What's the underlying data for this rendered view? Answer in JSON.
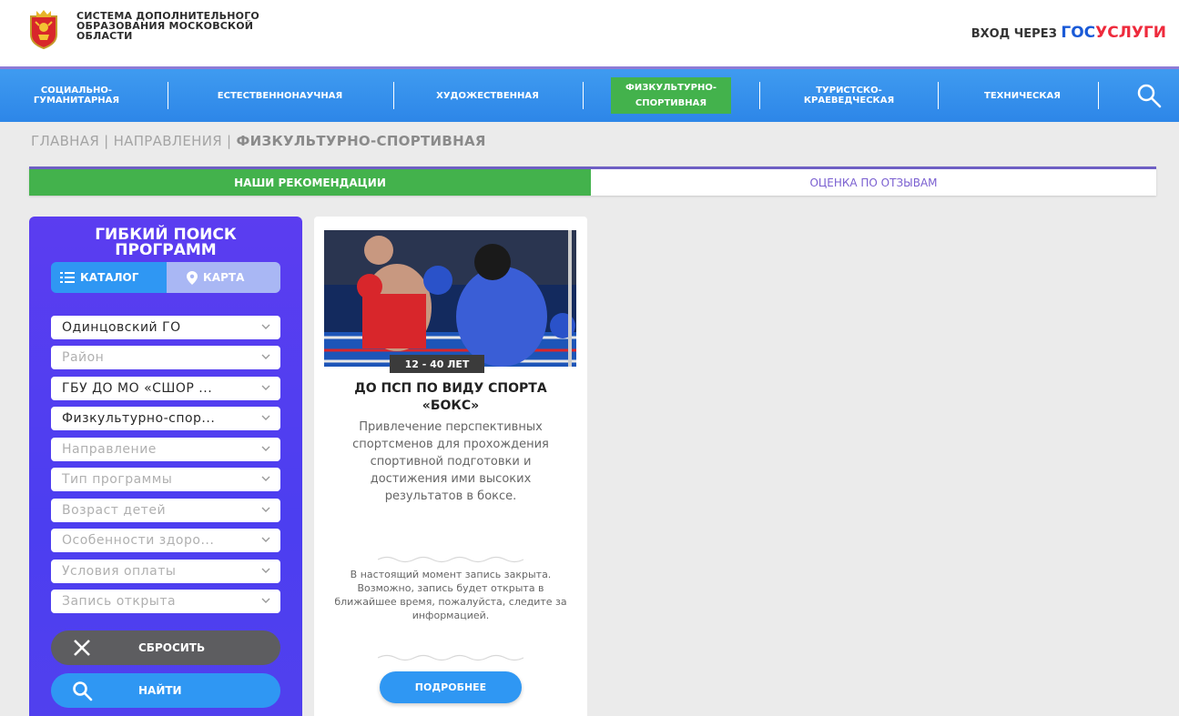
{
  "header": {
    "title_lines": [
      "СИСТЕМА ДОПОЛНИТЕЛЬНОГО",
      "ОБРАЗОВАНИЯ МОСКОВСКОЙ",
      "ОБЛАСТИ"
    ],
    "login_prefix": "ВХОД ЧЕРЕЗ",
    "login_gos": "ГОС",
    "login_uslugi": "УСЛУГИ"
  },
  "nav": {
    "items": [
      {
        "label_1": "СОЦИАЛЬНО-",
        "label_2": "ГУМАНИТАРНАЯ"
      },
      {
        "label_1": "ЕСТЕСТВЕННОНАУЧНАЯ",
        "label_2": ""
      },
      {
        "label_1": "ХУДОЖЕСТВЕННАЯ",
        "label_2": ""
      },
      {
        "label_1": "ФИЗКУЛЬТУРНО-",
        "label_2": "СПОРТИВНАЯ"
      },
      {
        "label_1": "ТУРИСТСКО-",
        "label_2": "КРАЕВЕДЧЕСКАЯ"
      },
      {
        "label_1": "ТЕХНИЧЕСКАЯ",
        "label_2": ""
      }
    ],
    "active_index": 3
  },
  "breadcrumb": {
    "home": "ГЛАВНАЯ",
    "sep": "|",
    "directions": "НАПРАВЛЕНИЯ",
    "current": "ФИЗКУЛЬТУРНО-СПОРТИВНАЯ"
  },
  "tabs": {
    "recommendations": "НАШИ РЕКОМЕНДАЦИИ",
    "reviews": "ОЦЕНКА ПО ОТЗЫВАМ"
  },
  "sidebar": {
    "title_1": "ГИБКИЙ ПОИСК",
    "title_2": "ПРОГРАММ",
    "catalog_label": "КАТАЛОГ",
    "map_label": "КАРТА",
    "filters": [
      {
        "value": "Одинцовский ГО",
        "selected": true
      },
      {
        "value": "Район",
        "selected": false
      },
      {
        "value": "ГБУ ДО МО «СШОР ...",
        "selected": true
      },
      {
        "value": "Физкультурно-спор...",
        "selected": true
      },
      {
        "value": "Направление",
        "selected": false
      },
      {
        "value": "Тип программы",
        "selected": false
      },
      {
        "value": "Возраст детей",
        "selected": false
      },
      {
        "value": "Особенности здоро...",
        "selected": false
      },
      {
        "value": "Условия оплаты",
        "selected": false
      },
      {
        "value": "Запись открыта",
        "selected": false
      }
    ],
    "reset_label": "СБРОСИТЬ",
    "find_label": "НАЙТИ"
  },
  "card": {
    "age": "12 - 40 ЛЕТ",
    "title_1": "ДО ПСП ПО ВИДУ СПОРТА",
    "title_2": "«БОКС»",
    "description": "Привлечение перспективных спортсменов для прохождения спортивной подготовки и достижения ими высоких результатов в боксе.",
    "note": "В настоящий момент запись закрыта. Возможно, запись будет открыта в ближайшее время, пожалуйста, следите за информацией.",
    "more_label": "ПОДРОБНЕЕ"
  },
  "colors": {
    "nav_blue": "#3f9bf0",
    "active_green": "#43b24c",
    "sidebar_purple": "#5b3df0",
    "button_blue": "#2f97f3",
    "reset_gray": "#5d5d60",
    "gos_blue": "#1a5ad7",
    "uslugi_red": "#ee2a3c"
  }
}
